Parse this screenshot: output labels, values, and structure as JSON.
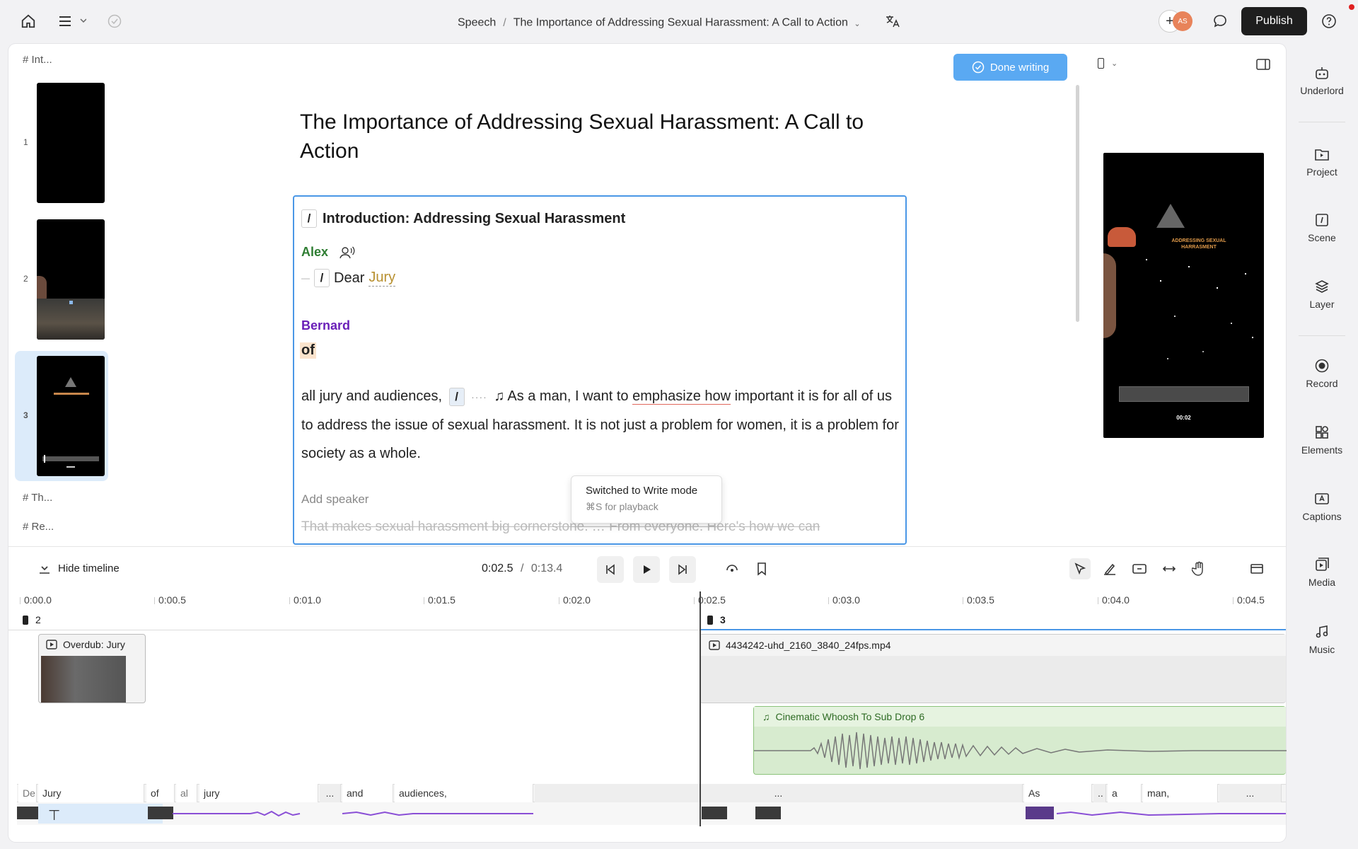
{
  "topbar": {
    "breadcrumb_root": "Speech",
    "breadcrumb_sep": "/",
    "doc_title": "The Importance of Addressing Sexual Harassment: A Call to Action",
    "publish_label": "Publish",
    "avatar_initials": "AS"
  },
  "scenes": {
    "header_intro": "# Int...",
    "header_th": "# Th...",
    "header_re": "# Re...",
    "items": [
      {
        "num": "1"
      },
      {
        "num": "2"
      },
      {
        "num": "3"
      }
    ]
  },
  "editor": {
    "done_label": "Done writing",
    "title": "The Importance of Addressing Sexual Harassment: A Call to Action",
    "section_title": "Introduction: Addressing Sexual Harassment",
    "speaker1": "Alex",
    "line1_word1": "Dear",
    "line1_word2": "Jury",
    "speaker2": "Bernard",
    "line2": "of",
    "para_pre": "all jury and audiences,",
    "para_a": "As a man, I want to ",
    "para_emph": "emphasize how",
    "para_b": " important it is for all of us to address the issue of sexual harassment.",
    "para_c": "It is not just a problem for women, it is a problem for society as a whole.",
    "add_speaker": "Add speaker",
    "struck_line": "That makes sexual harassment big cornerstone. … From everyone. Here's how we can"
  },
  "tooltip": {
    "title": "Switched to Write mode",
    "hint": "⌘S for playback"
  },
  "preview": {
    "overlay_title": "ADDRESSING SEXUAL HARRASMENT",
    "timestamp": "00:02"
  },
  "rail": {
    "items": [
      {
        "label": "Underlord",
        "icon": "robot-icon"
      },
      {
        "label": "Project",
        "icon": "folder-icon"
      },
      {
        "label": "Scene",
        "icon": "scene-icon"
      },
      {
        "label": "Layer",
        "icon": "layers-icon"
      },
      {
        "label": "Record",
        "icon": "record-icon"
      },
      {
        "label": "Elements",
        "icon": "elements-icon"
      },
      {
        "label": "Captions",
        "icon": "captions-icon"
      },
      {
        "label": "Media",
        "icon": "media-icon"
      },
      {
        "label": "Music",
        "icon": "music-icon"
      }
    ]
  },
  "timeline": {
    "hide_label": "Hide timeline",
    "current_time": "0:02.5",
    "time_sep": "/",
    "total_time": "0:13.4",
    "ruler": [
      "0:00.0",
      "0:00.5",
      "0:01.0",
      "0:01.5",
      "0:02.0",
      "0:02.5",
      "0:03.0",
      "0:03.5",
      "0:04.0",
      "0:04.5"
    ],
    "scene_a": "2",
    "scene_b": "3",
    "clip_overdub": "Overdub: Jury",
    "clip_video": "4434242-uhd_2160_3840_24fps.mp4",
    "clip_music": "Cinematic Whoosh To Sub Drop 6",
    "words": [
      "De",
      "Jury",
      "of",
      "al",
      "jury",
      "...",
      "and",
      "audiences,",
      "...",
      "As",
      "..",
      "a",
      "man,",
      "..."
    ]
  }
}
